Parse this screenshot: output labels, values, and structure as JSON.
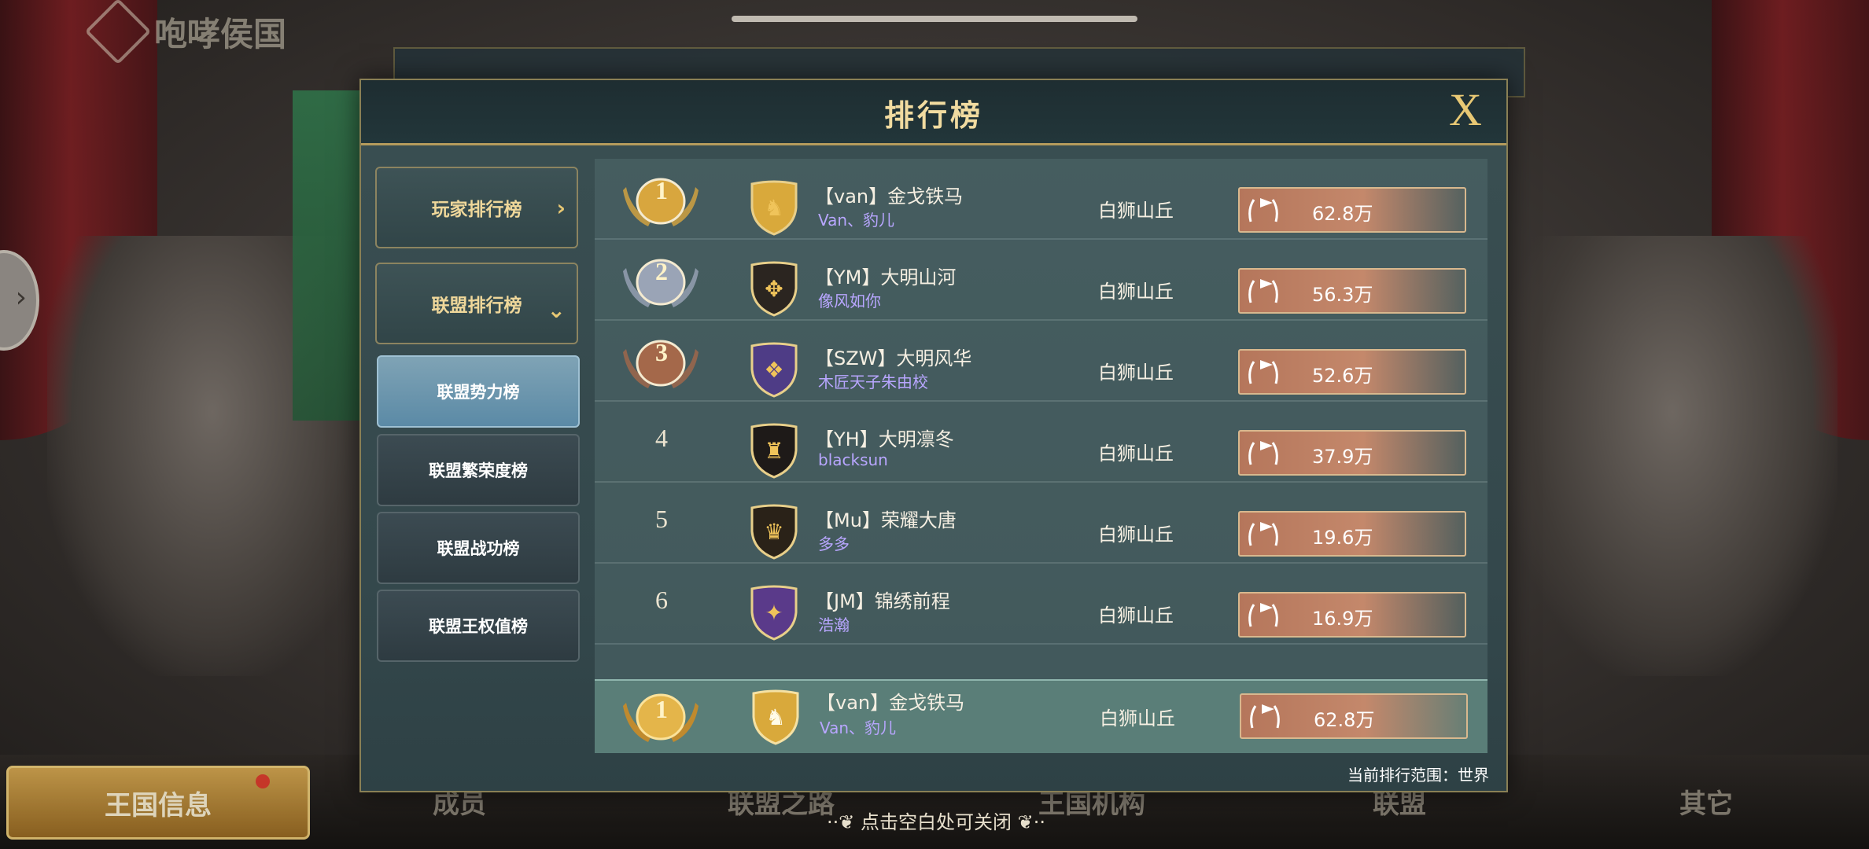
{
  "background": {
    "title": "咆哮侯国",
    "bottom_tabs": [
      "王国信息",
      "成员",
      "联盟之路",
      "王国机构",
      "联盟",
      "其它"
    ]
  },
  "modal": {
    "title": "排行榜",
    "close_label": "X"
  },
  "sidebar": {
    "categories": [
      {
        "label": "玩家排行榜",
        "expanded": false
      },
      {
        "label": "联盟排行榜",
        "expanded": true
      }
    ],
    "sub_items": [
      {
        "label": "联盟势力榜",
        "active": true
      },
      {
        "label": "联盟繁荣度榜",
        "active": false
      },
      {
        "label": "联盟战功榜",
        "active": false
      },
      {
        "label": "联盟王权值榜",
        "active": false
      }
    ]
  },
  "rankings": [
    {
      "rank": "1",
      "team": "【van】金戈铁马",
      "leader": "Van、豹儿",
      "server": "白狮山丘",
      "power": "62.8万",
      "shield_color": "#d9a93b",
      "emblem": "unicorn-icon"
    },
    {
      "rank": "2",
      "team": "【YM】大明山河",
      "leader": "像风如你",
      "server": "白狮山丘",
      "power": "56.3万",
      "shield_color": "#2b2520",
      "emblem": "double-eagle-icon"
    },
    {
      "rank": "3",
      "team": "【SZW】大明风华",
      "leader": "木匠天子朱由校",
      "server": "白狮山丘",
      "power": "52.6万",
      "shield_color": "#4e3c86",
      "emblem": "glyph-icon"
    },
    {
      "rank": "4",
      "team": "【YH】大明凛冬",
      "leader": "blacksun",
      "server": "白狮山丘",
      "power": "37.9万",
      "shield_color": "#1e1a18",
      "emblem": "dragon-icon"
    },
    {
      "rank": "5",
      "team": "【Mu】荣耀大唐",
      "leader": "多多",
      "server": "白狮山丘",
      "power": "19.6万",
      "shield_color": "#2a2218",
      "emblem": "lion-icon"
    },
    {
      "rank": "6",
      "team": "【JM】锦绣前程",
      "leader": "浩瀚",
      "server": "白狮山丘",
      "power": "16.9万",
      "shield_color": "#5a3a8a",
      "emblem": "eagle-icon"
    }
  ],
  "my_alliance": {
    "rank": "1",
    "team": "【van】金戈铁马",
    "leader": "Van、豹儿",
    "server": "白狮山丘",
    "power": "62.8万",
    "shield_color": "#d9a93b",
    "emblem": "unicorn-icon"
  },
  "scope_text": "当前排行范围：世界",
  "tap_hint": "点击空白处可关闭",
  "colors": {
    "gold": "#efd79a",
    "medal_gold": "#d8a63e",
    "medal_silver": "#9aa4b6",
    "medal_bronze": "#a4684a",
    "leader_text": "#b8a6ff",
    "power_fill": "#b5765b"
  }
}
